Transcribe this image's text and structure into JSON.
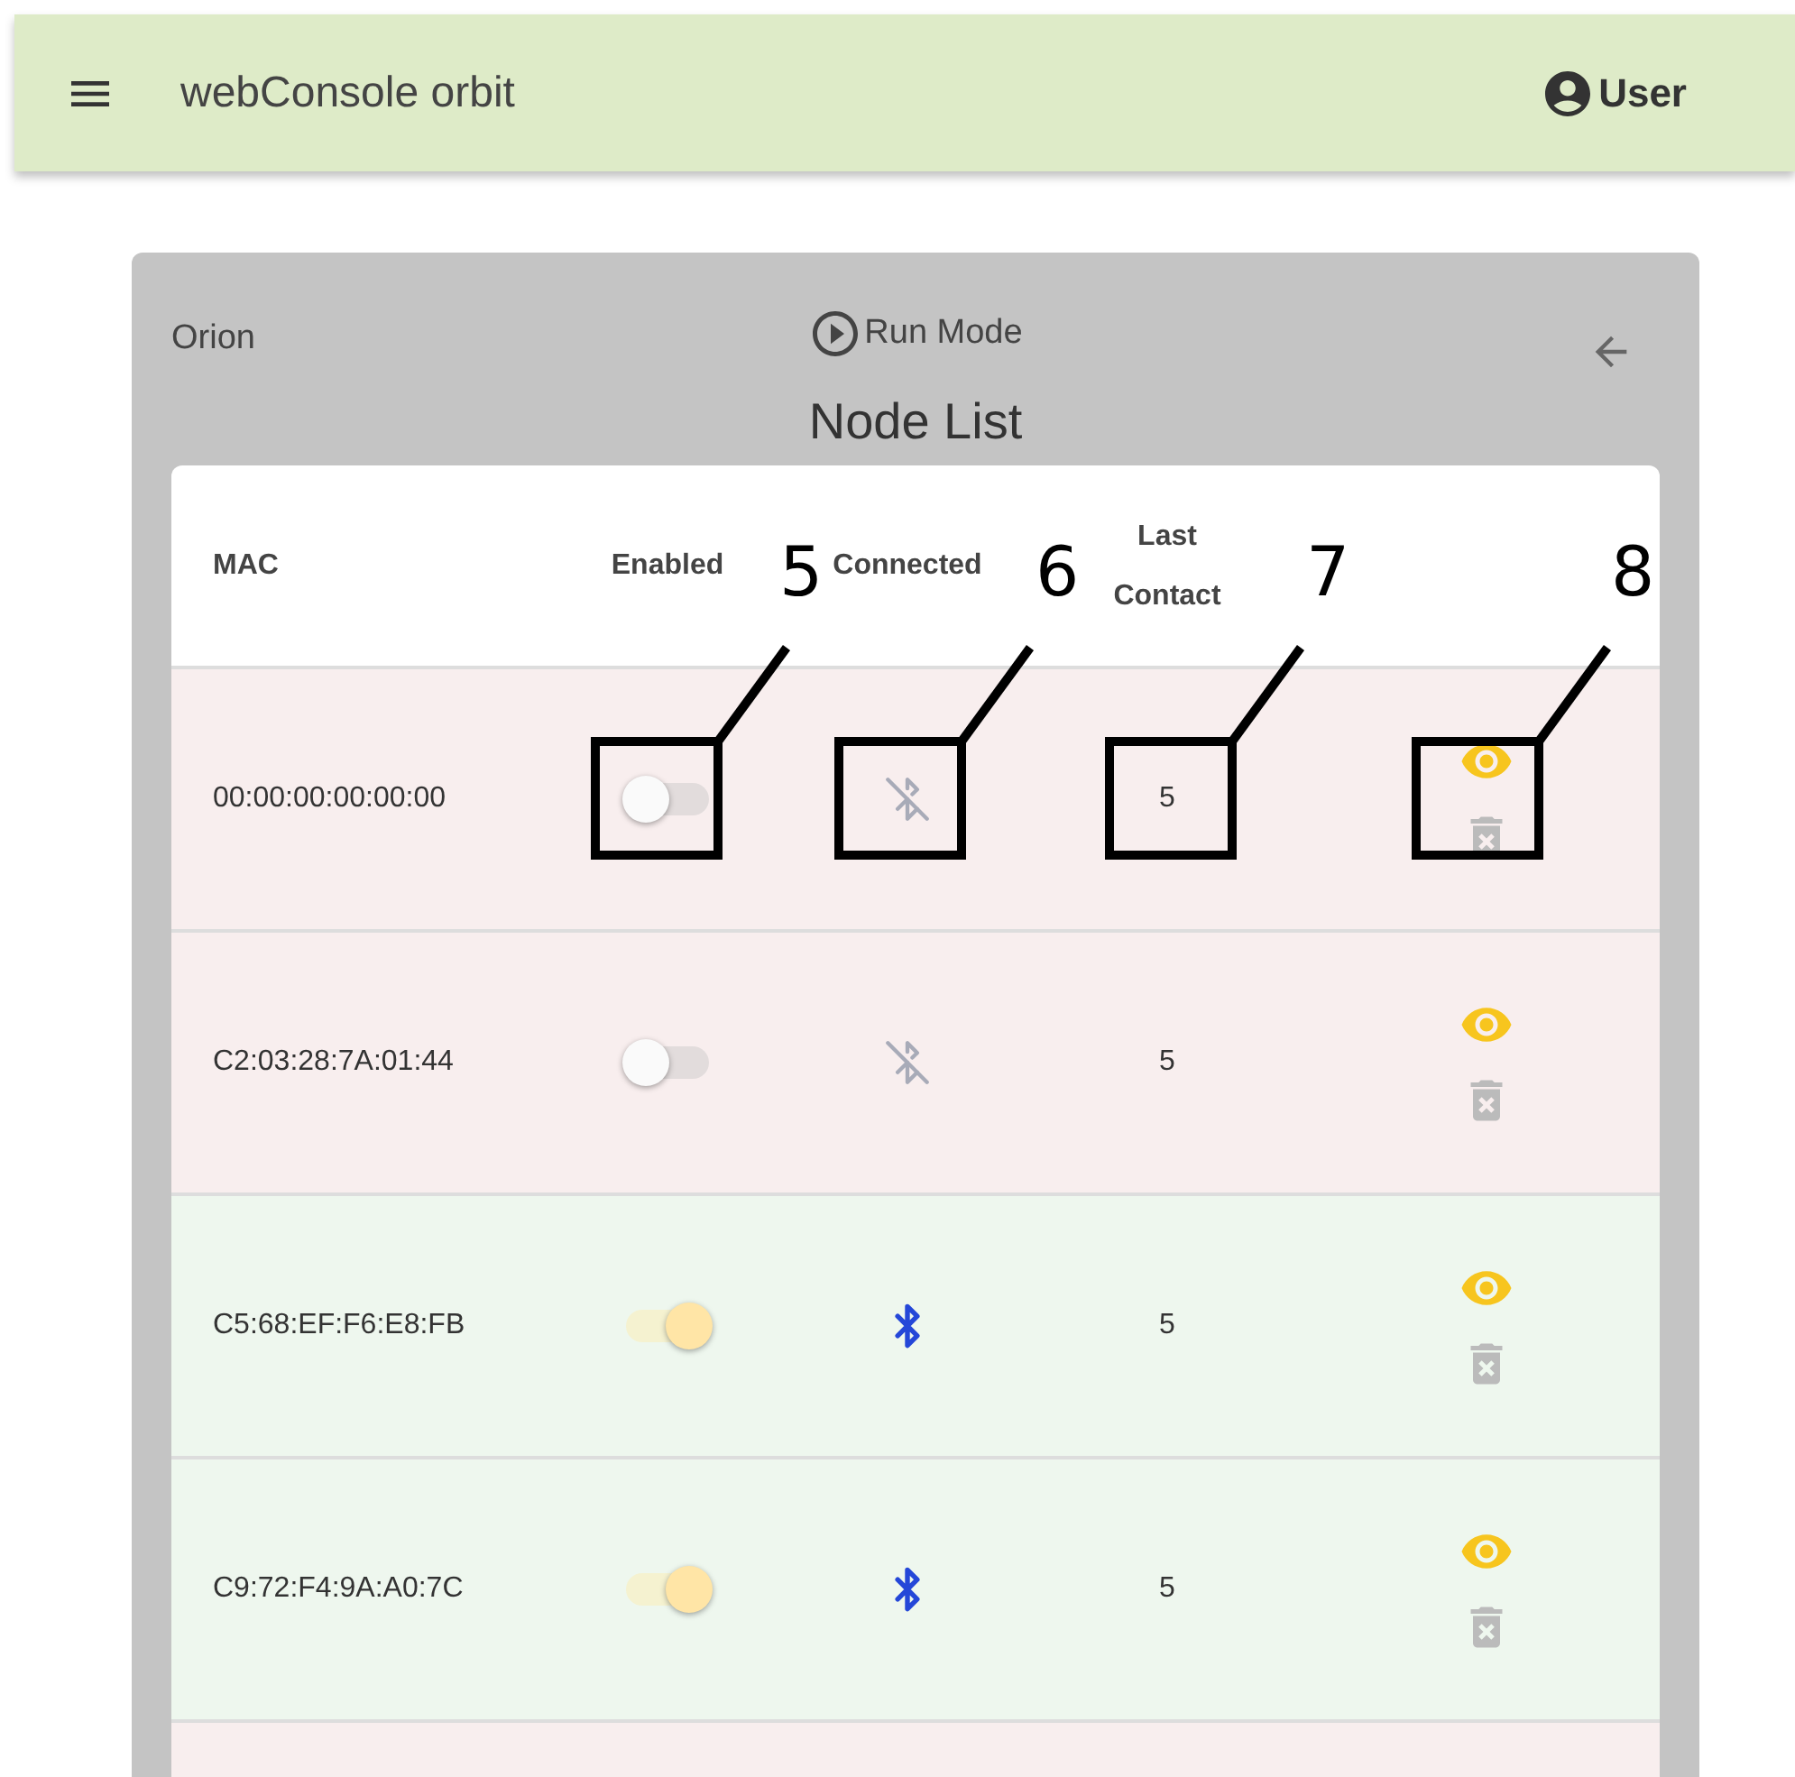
{
  "app_bar": {
    "title": "webConsole orbit",
    "user": "User"
  },
  "panel": {
    "name": "Orion",
    "mode": "Run Mode",
    "title": "Node List"
  },
  "table": {
    "columns": [
      "MAC",
      "Enabled",
      "Connected",
      "Last Contact"
    ],
    "rows": [
      {
        "mac": "00:00:00:00:00:00",
        "enabled": false,
        "connected": false,
        "last_contact": "5"
      },
      {
        "mac": "C2:03:28:7A:01:44",
        "enabled": false,
        "connected": false,
        "last_contact": "5"
      },
      {
        "mac": "C5:68:EF:F6:E8:FB",
        "enabled": true,
        "connected": true,
        "last_contact": "5"
      },
      {
        "mac": "C9:72:F4:9A:A0:7C",
        "enabled": true,
        "connected": true,
        "last_contact": "5"
      }
    ]
  },
  "annotations": [
    {
      "label": "5"
    },
    {
      "label": "6"
    },
    {
      "label": "7"
    },
    {
      "label": "8"
    }
  ]
}
